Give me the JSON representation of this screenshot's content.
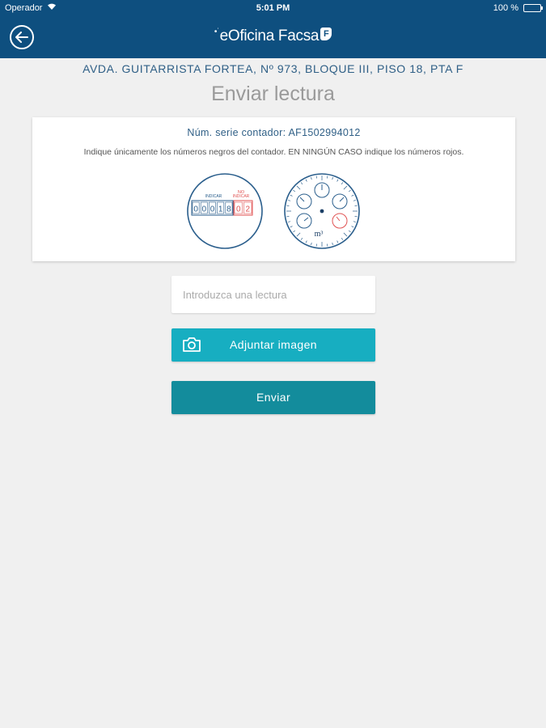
{
  "status_bar": {
    "carrier": "Operador",
    "time": "5:01 PM",
    "battery": "100 %",
    "battery_level": 1.0
  },
  "header": {
    "brand": "eOficina Facsa",
    "brand_badge": "F",
    "back_icon": "back-arrow-circle-icon"
  },
  "address": "AVDA. GUITARRISTA FORTEA, Nº 973, BLOQUE III, PISO 18, PTA F",
  "page_title": "Enviar lectura",
  "card": {
    "serial": "Núm. serie contador: AF1502994012",
    "instructions": "Indique únicamente los números negros del contador. EN NINGÚN CASO indique los números rojos.",
    "digital_meter": {
      "label_black": "INDICAR",
      "label_red_1": "NO",
      "label_red_2": "INDICAR",
      "digits_black": [
        "0",
        "0",
        "0",
        "1",
        "8"
      ],
      "digits_red": [
        "0",
        "2"
      ]
    },
    "dial_meter": {
      "unit": "m³"
    }
  },
  "form": {
    "reading_placeholder": "Introduzca una lectura",
    "reading_value": "",
    "attach_label": "Adjuntar imagen",
    "send_label": "Enviar"
  },
  "colors": {
    "primary": "#0e4f7f",
    "attach": "#17aec1",
    "send": "#138c9c",
    "warning_red": "#e05252"
  }
}
